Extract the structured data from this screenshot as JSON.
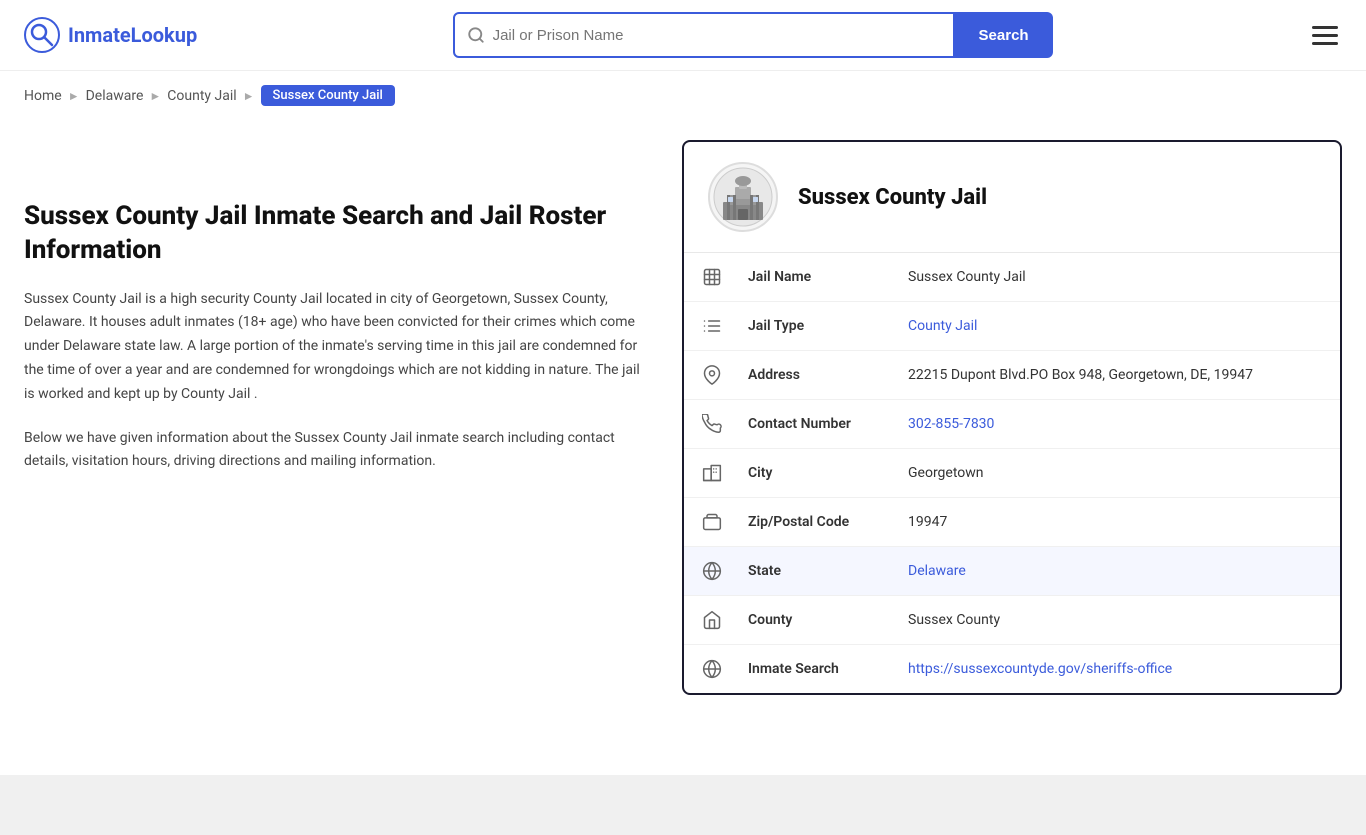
{
  "header": {
    "logo_text_plain": "Inmate",
    "logo_text_accent": "Lookup",
    "search_placeholder": "Jail or Prison Name",
    "search_button_label": "Search",
    "menu_label": "Menu"
  },
  "breadcrumb": {
    "items": [
      {
        "label": "Home",
        "href": "#"
      },
      {
        "label": "Delaware",
        "href": "#"
      },
      {
        "label": "County Jail",
        "href": "#"
      },
      {
        "label": "Sussex County Jail",
        "active": true
      }
    ]
  },
  "left": {
    "title": "Sussex County Jail Inmate Search and Jail Roster Information",
    "description1": "Sussex County Jail is a high security County Jail located in city of Georgetown, Sussex County, Delaware. It houses adult inmates (18+ age) who have been convicted for their crimes which come under Delaware state law. A large portion of the inmate's serving time in this jail are condemned for the time of over a year and are condemned for wrongdoings which are not kidding in nature. The jail is worked and kept up by County Jail .",
    "description2": "Below we have given information about the Sussex County Jail inmate search including contact details, visitation hours, driving directions and mailing information."
  },
  "card": {
    "jail_name_header": "Sussex County Jail",
    "rows": [
      {
        "label": "Jail Name",
        "value": "Sussex County Jail",
        "link": null,
        "icon": "jail-icon",
        "highlighted": false
      },
      {
        "label": "Jail Type",
        "value": "County Jail",
        "link": "#",
        "icon": "list-icon",
        "highlighted": false
      },
      {
        "label": "Address",
        "value": "22215 Dupont Blvd.PO Box 948, Georgetown, DE, 19947",
        "link": null,
        "icon": "pin-icon",
        "highlighted": false
      },
      {
        "label": "Contact Number",
        "value": "302-855-7830",
        "link": "tel:302-855-7830",
        "icon": "phone-icon",
        "highlighted": false
      },
      {
        "label": "City",
        "value": "Georgetown",
        "link": null,
        "icon": "city-icon",
        "highlighted": false
      },
      {
        "label": "Zip/Postal Code",
        "value": "19947",
        "link": null,
        "icon": "mail-icon",
        "highlighted": false
      },
      {
        "label": "State",
        "value": "Delaware",
        "link": "#",
        "icon": "globe-icon",
        "highlighted": true
      },
      {
        "label": "County",
        "value": "Sussex County",
        "link": null,
        "icon": "county-icon",
        "highlighted": false
      },
      {
        "label": "Inmate Search",
        "value": "https://sussexcountyde.gov/sheriffs-office",
        "link": "https://sussexcountyde.gov/sheriffs-office",
        "icon": "globe2-icon",
        "highlighted": false
      }
    ]
  }
}
